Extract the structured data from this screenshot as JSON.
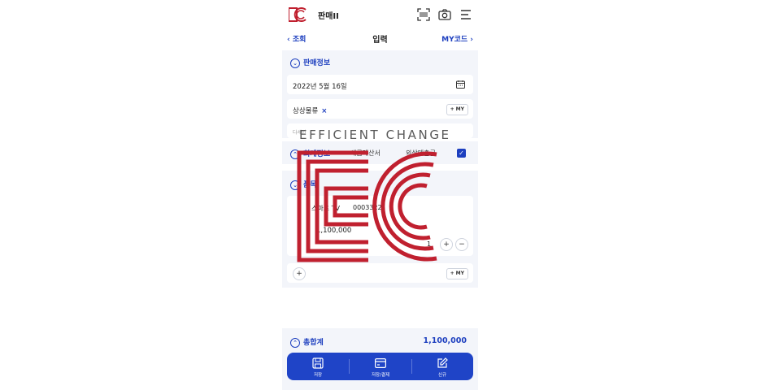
{
  "header": {
    "app_title": "판매II"
  },
  "nav": {
    "back_label": "‹ 조회",
    "title": "입력",
    "my_code_label": "MY코드 ›"
  },
  "sales_info": {
    "heading": "판매정보",
    "date_value": "2022년 5월 16일",
    "item_value": "상상물류",
    "item_remove": "×",
    "my_label": "+ MY",
    "partial_row_text": "다세인"
  },
  "accounting": {
    "heading": "회계정보",
    "tab1": "세금계산서",
    "tab2": "외상매출금",
    "checked": "✓"
  },
  "items": {
    "heading": "품목",
    "product_name": "스마트 TV",
    "product_code": "0003322",
    "amount": "1,100,000",
    "qty": "1",
    "plus": "+",
    "minus": "−",
    "add_label": "+",
    "my_label": "+ MY"
  },
  "total": {
    "heading": "총합계",
    "value": "1,100,000"
  },
  "footer": {
    "save_label": "저장",
    "save_pay_label": "저장/결제",
    "new_label": "신규"
  },
  "watermark": {
    "text": "EFFICIENT CHANGE"
  },
  "colors": {
    "accent": "#1d3fbf",
    "footer": "#1f44c7",
    "brand_red": "#c0202f",
    "panel_bg": "#f3f5fa"
  }
}
